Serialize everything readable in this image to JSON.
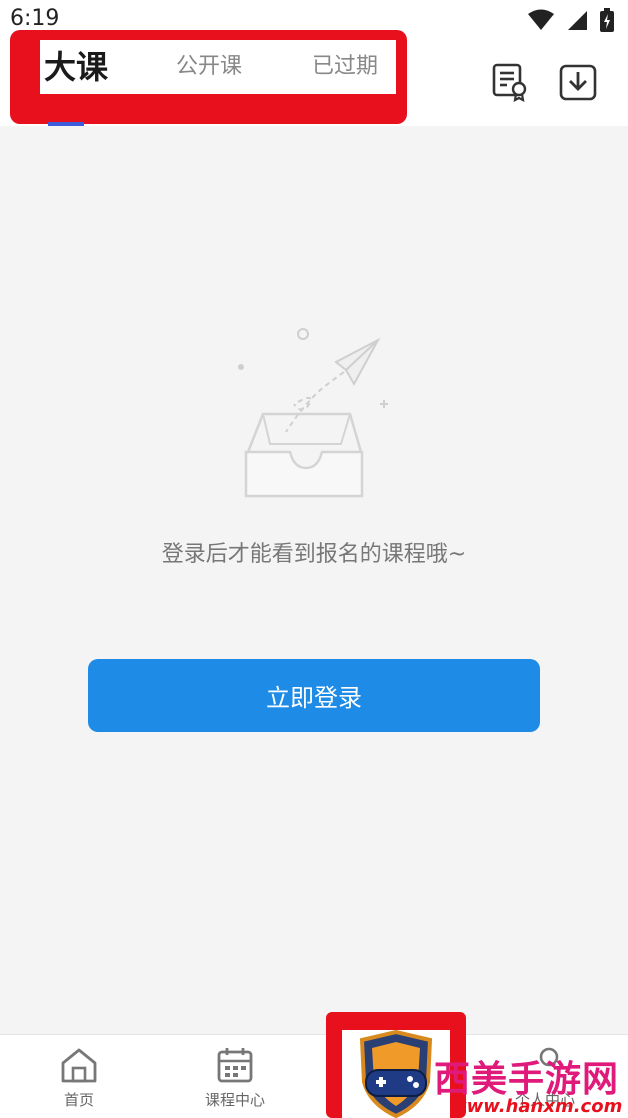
{
  "status_bar": {
    "time": "6:19"
  },
  "header": {
    "tabs": [
      {
        "label": "大课",
        "active": true
      },
      {
        "label": "公开课",
        "active": false
      },
      {
        "label": "已过期",
        "active": false
      }
    ],
    "icons": [
      "certificate-icon",
      "download-icon"
    ]
  },
  "empty_state": {
    "message": "登录后才能看到报名的课程哦~",
    "login_button": "立即登录",
    "illustration": "empty-box-paper-plane-icon"
  },
  "bottom_nav": {
    "items": [
      {
        "label": "首页",
        "icon": "home-icon"
      },
      {
        "label": "课程中心",
        "icon": "calendar-icon"
      },
      {
        "label": "",
        "icon": "study-icon"
      },
      {
        "label": "个人中心",
        "icon": "person-icon"
      }
    ]
  },
  "watermark": {
    "title": "西美手游网",
    "url": "www.hanxm.com"
  },
  "colors": {
    "accent": "#1e8be6",
    "highlight": "#e8101c",
    "tab_indicator": "#3b5bdb"
  }
}
